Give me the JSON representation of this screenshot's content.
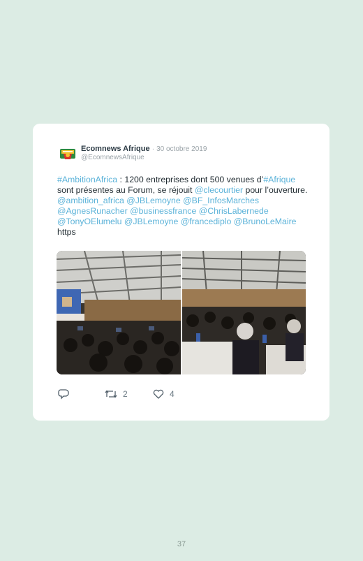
{
  "tweet": {
    "author_name": "Ecomnews Afrique",
    "separator": "·",
    "date": "30 octobre 2019",
    "handle": "@EcomnewsAfrique",
    "text_parts": [
      {
        "text": "#AmbitionAfrica",
        "link": true
      },
      {
        "text": " : 1200 entreprises dont 500 venues d’",
        "link": false
      },
      {
        "text": "#Afrique",
        "link": true
      },
      {
        "text": " sont présentes au Forum, se réjouit ",
        "link": false
      },
      {
        "text": "@clecourtier",
        "link": true
      },
      {
        "text": " pour l’ouverture. ",
        "link": false
      },
      {
        "text": "@ambition_africa",
        "link": true
      },
      {
        "text": " ",
        "link": false
      },
      {
        "text": "@JBLemoyne",
        "link": true
      },
      {
        "text": " ",
        "link": false
      },
      {
        "text": "@BF_InfosMarches",
        "link": true
      },
      {
        "text": " ",
        "link": false
      },
      {
        "text": "@AgnesRunacher",
        "link": true
      },
      {
        "text": " ",
        "link": false
      },
      {
        "text": "@businessfrance",
        "link": true
      },
      {
        "text": " ",
        "link": false
      },
      {
        "text": "@ChrisLabernede",
        "link": true
      },
      {
        "text": " ",
        "link": false
      },
      {
        "text": "@TonyOElumelu",
        "link": true
      },
      {
        "text": " ",
        "link": false
      },
      {
        "text": "@JBLemoyne",
        "link": true
      },
      {
        "text": " ",
        "link": false
      },
      {
        "text": "@francediplo",
        "link": true
      },
      {
        "text": " ",
        "link": false
      },
      {
        "text": "@BrunoLeMaire",
        "link": true
      },
      {
        "text": " https",
        "link": false
      }
    ],
    "retweet_count": "2",
    "like_count": "4"
  },
  "icons": {
    "reply": "speech-bubble-icon",
    "retweet": "retweet-arrows-icon",
    "like": "heart-icon"
  },
  "colors": {
    "page_background": "#dcece4",
    "link": "#5cb3d9",
    "text": "#1f2a30",
    "muted": "#9aa3a8"
  },
  "page_number": "37"
}
